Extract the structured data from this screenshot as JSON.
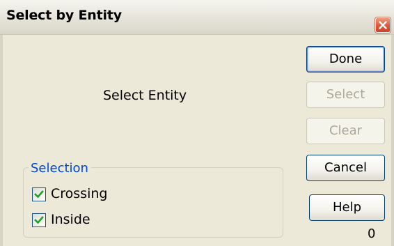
{
  "window": {
    "title": "Select by Entity"
  },
  "prompt": "Select Entity",
  "buttons": {
    "done": "Done",
    "select": "Select",
    "clear": "Clear",
    "cancel": "Cancel",
    "help": "Help"
  },
  "selection_group": {
    "legend": "Selection",
    "options": [
      {
        "label": "Crossing",
        "checked": true
      },
      {
        "label": "Inside",
        "checked": true
      }
    ]
  },
  "count": "0",
  "colors": {
    "accent": "#0046d5",
    "checkmark": "#21a121",
    "close_button": "#e0573a",
    "disabled_text": "#aca899"
  },
  "icons": {
    "close": "close-icon",
    "check": "checkmark-icon"
  }
}
